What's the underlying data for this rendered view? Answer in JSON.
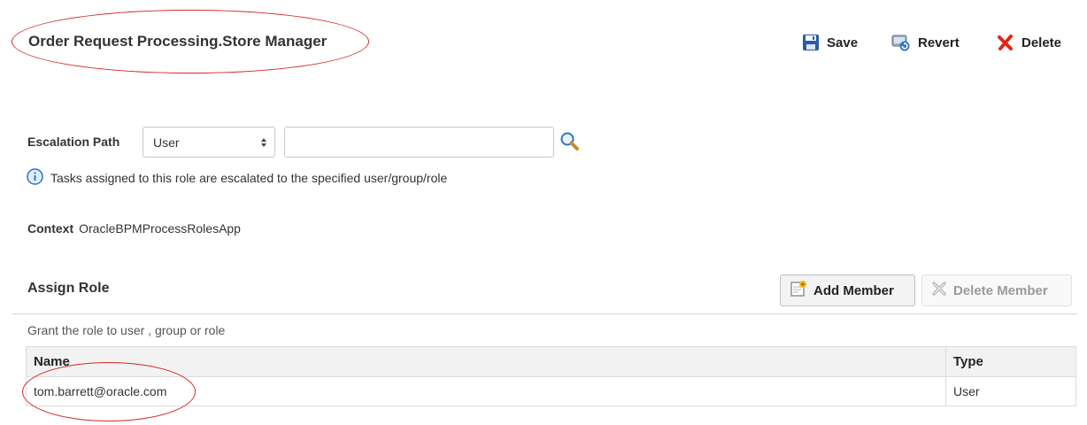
{
  "header": {
    "title": "Order Request Processing.Store Manager",
    "save_label": "Save",
    "revert_label": "Revert",
    "delete_label": "Delete"
  },
  "escalation": {
    "label": "Escalation Path",
    "type_selected": "User",
    "value": "",
    "info_text": "Tasks assigned to this role are escalated to the specified user/group/role"
  },
  "context": {
    "label": "Context",
    "value": "OracleBPMProcessRolesApp"
  },
  "assign_role": {
    "heading": "Assign Role",
    "add_member_label": "Add Member",
    "delete_member_label": "Delete Member",
    "description": "Grant the role to user , group or role",
    "columns": [
      "Name",
      "Type"
    ],
    "rows": [
      {
        "name": "tom.barrett@oracle.com",
        "type": "User"
      }
    ]
  },
  "annotation_color": "#d32a2a",
  "icons": {
    "save": "save-icon",
    "revert": "revert-icon",
    "delete": "delete-x-icon",
    "search": "search-icon",
    "info": "info-icon",
    "add_member": "add-member-icon",
    "delete_member": "delete-member-icon"
  }
}
